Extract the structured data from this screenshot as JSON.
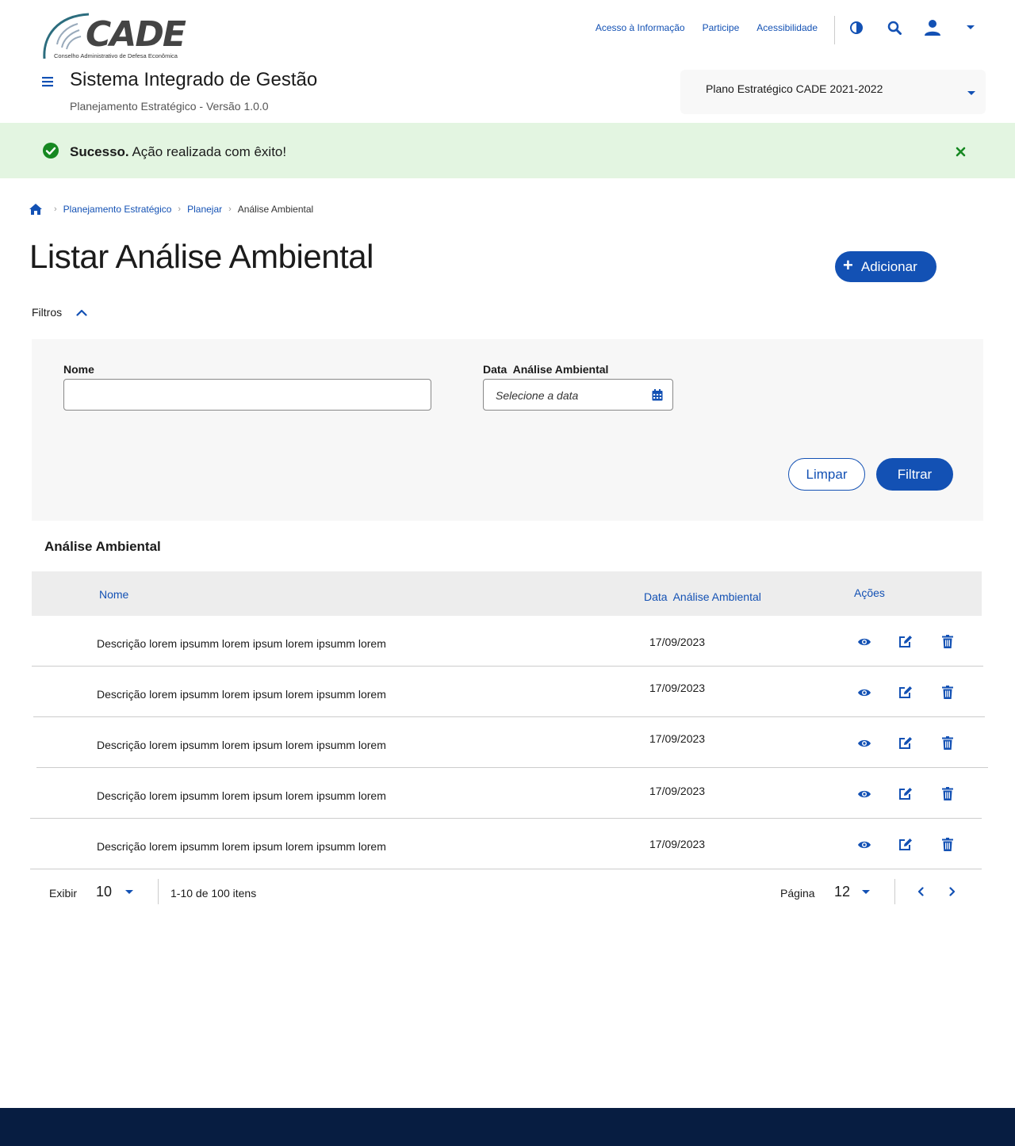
{
  "logo": {
    "word": "CADE",
    "subtitle": "Conselho Administrativo de Defesa Econômica"
  },
  "top_links": [
    "Acesso à Informação",
    "Participe",
    "Acessibilidade"
  ],
  "top_icons": [
    "contrast-icon",
    "search-icon",
    "user-icon",
    "caret-down-icon"
  ],
  "header": {
    "title": "Sistema Integrado de Gestão",
    "subtitle": "Planejamento Estratégico - Versão 1.0.0",
    "plan_select": "Plano Estratégico CADE 2021-2022"
  },
  "alert": {
    "strong": "Sucesso.",
    "message": " Ação realizada com êxito!"
  },
  "breadcrumb": {
    "items": [
      "Planejamento Estratégico",
      "Planejar"
    ],
    "current": "Análise Ambiental"
  },
  "page": {
    "title": "Listar Análise Ambiental",
    "add_button": "Adicionar",
    "filters_label": "Filtros"
  },
  "filters": {
    "name_label": "Nome",
    "name_value": "",
    "date_label": "Data  Análise Ambiental",
    "date_placeholder": "Selecione a data",
    "clear_button": "Limpar",
    "filter_button": "Filtrar"
  },
  "table": {
    "title": "Análise Ambiental",
    "columns": [
      "Nome",
      "Data  Análise Ambiental",
      "Ações"
    ],
    "rows": [
      {
        "name": "Descrição lorem ipsumm lorem ipsum lorem ipsumm lorem",
        "date": "17/09/2023"
      },
      {
        "name": "Descrição lorem ipsumm lorem ipsum lorem ipsumm lorem",
        "date": "17/09/2023"
      },
      {
        "name": "Descrição lorem ipsumm lorem ipsum lorem ipsumm lorem",
        "date": "17/09/2023"
      },
      {
        "name": "Descrição lorem ipsumm lorem ipsum lorem ipsumm lorem",
        "date": "17/09/2023"
      },
      {
        "name": "Descrição lorem ipsumm lorem ipsum lorem ipsumm lorem",
        "date": "17/09/2023"
      }
    ]
  },
  "pagination": {
    "show_label": "Exibir",
    "page_size": "10",
    "range": "1-10 de 100 itens",
    "page_label": "Página",
    "page": "12"
  },
  "colors": {
    "primary": "#1351b4",
    "success_bg": "#e3f5e1",
    "success_icon": "#168821",
    "footer": "#071d41"
  }
}
